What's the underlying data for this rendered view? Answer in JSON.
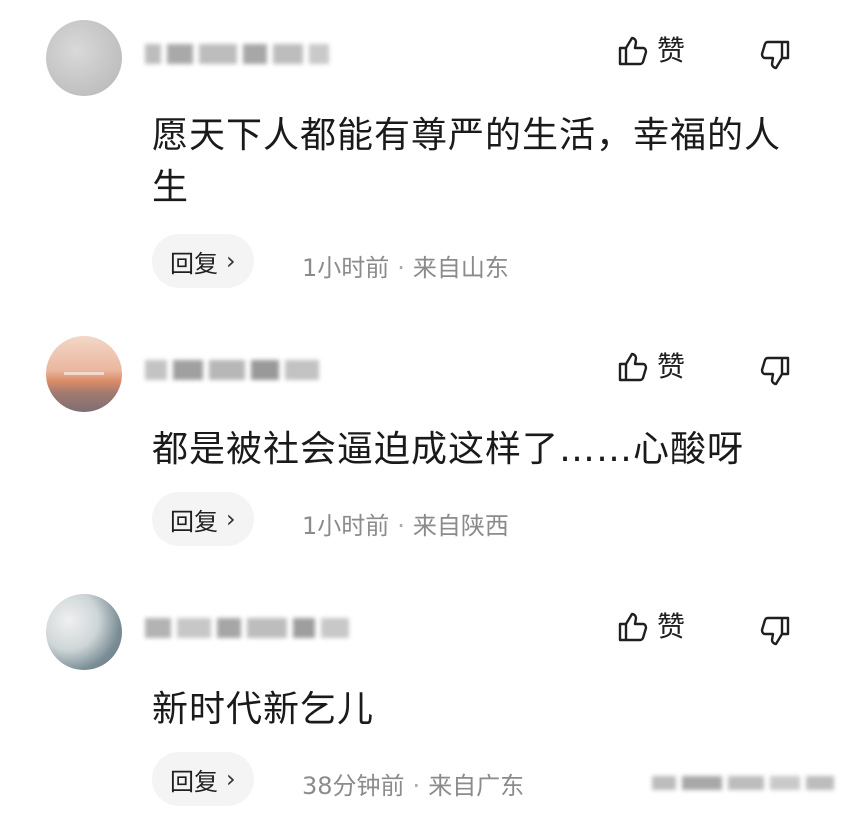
{
  "comments": [
    {
      "avatar": "blurred-avatar",
      "like_label": "赞",
      "content": "愿天下人都能有尊严的生活，幸福的人生",
      "reply_label": "回复",
      "time": "1小时前",
      "location": "来自山东"
    },
    {
      "avatar": "sunset-avatar",
      "like_label": "赞",
      "content": "都是被社会逼迫成这样了……心酸呀",
      "reply_label": "回复",
      "time": "1小时前",
      "location": "来自陕西"
    },
    {
      "avatar": "landscape-avatar",
      "like_label": "赞",
      "content": "新时代新乞儿",
      "reply_label": "回复",
      "time": "38分钟前",
      "location": "来自广东"
    }
  ],
  "icons": {
    "like": "thumbs-up-icon",
    "dislike": "thumbs-down-icon",
    "reply_chevron": "chevron-right-icon"
  },
  "colors": {
    "text": "#1f1f1f",
    "meta": "#8b8b8b",
    "reply_bg": "#f4f4f4"
  }
}
